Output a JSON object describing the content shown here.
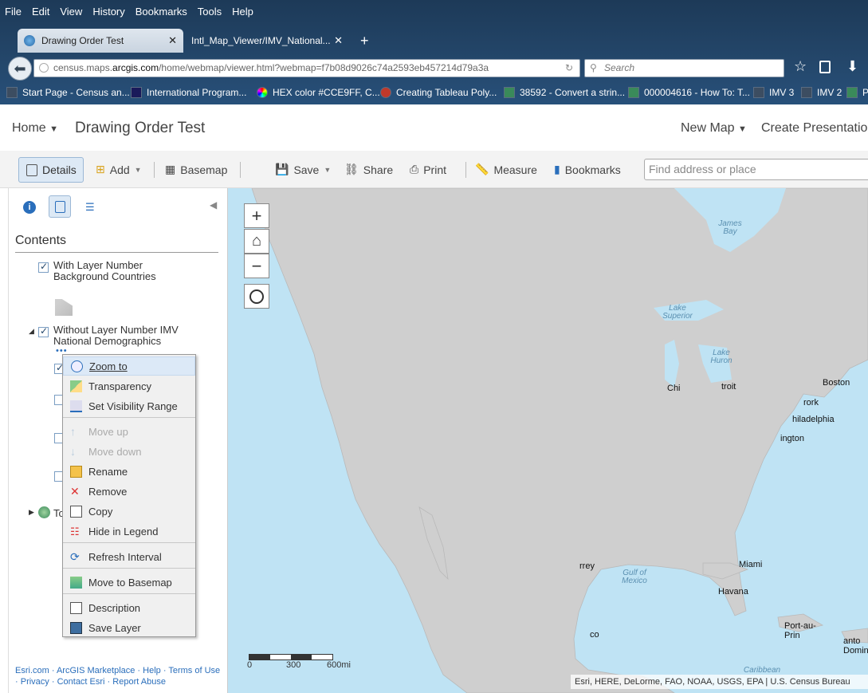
{
  "browser": {
    "menu": [
      "File",
      "Edit",
      "View",
      "History",
      "Bookmarks",
      "Tools",
      "Help"
    ],
    "tabs": [
      {
        "title": "Drawing Order Test",
        "active": true
      },
      {
        "title": "Intl_Map_Viewer/IMV_National...",
        "active": false
      }
    ],
    "url": {
      "prefix": "census.maps.",
      "domain": "arcgis.com",
      "path": "/home/webmap/viewer.html?webmap=f7b08d9026c74a2593eb457214d79a3a"
    },
    "search_placeholder": "Search",
    "bookmarks": [
      "Start Page - Census an...",
      "International Program...",
      "HEX color #CCE9FF, C...",
      "Creating Tableau Poly...",
      "38592 - Convert a strin...",
      "000004616 - How To: T...",
      "IMV 3",
      "IMV 2",
      "P"
    ]
  },
  "header": {
    "home": "Home",
    "title": "Drawing Order Test",
    "new_map": "New Map",
    "create_presentation": "Create Presentation"
  },
  "toolbar": {
    "details": "Details",
    "add": "Add",
    "basemap": "Basemap",
    "save": "Save",
    "share": "Share",
    "print": "Print",
    "measure": "Measure",
    "bookmarks": "Bookmarks",
    "find_placeholder": "Find address or place"
  },
  "sidebar": {
    "contents_title": "Contents",
    "layer1": {
      "line1": "With Layer Number",
      "line2": "Background Countries"
    },
    "layer2": {
      "line1": "Without Layer Number IMV",
      "line2": "National Demographics"
    },
    "layer_partial": "To",
    "footer": {
      "links": [
        "Esri.com",
        "ArcGIS Marketplace",
        "Help",
        "Terms of Use",
        "Privacy",
        "Contact Esri",
        "Report Abuse"
      ]
    }
  },
  "context_menu": {
    "items": [
      "Zoom to",
      "Transparency",
      "Set Visibility Range",
      "Move up",
      "Move down",
      "Rename",
      "Remove",
      "Copy",
      "Hide in Legend",
      "Refresh Interval",
      "Move to Basemap",
      "Description",
      "Save Layer"
    ]
  },
  "map": {
    "places": [
      "James Bay",
      "Lake Superior",
      "Lake Huron",
      "Chi",
      "troit",
      "Boston",
      "rork",
      "hiladelphia",
      "ington",
      "Gulf of Mexico",
      "Miami",
      "Havana",
      "rrey",
      "co",
      "Port-au-Prin",
      "anto Doming",
      "Caribbean"
    ],
    "scale": {
      "labels": [
        "0",
        "300",
        "600mi"
      ]
    },
    "attribution": "Esri, HERE, DeLorme, FAO, NOAA, USGS, EPA | U.S. Census Bureau"
  }
}
